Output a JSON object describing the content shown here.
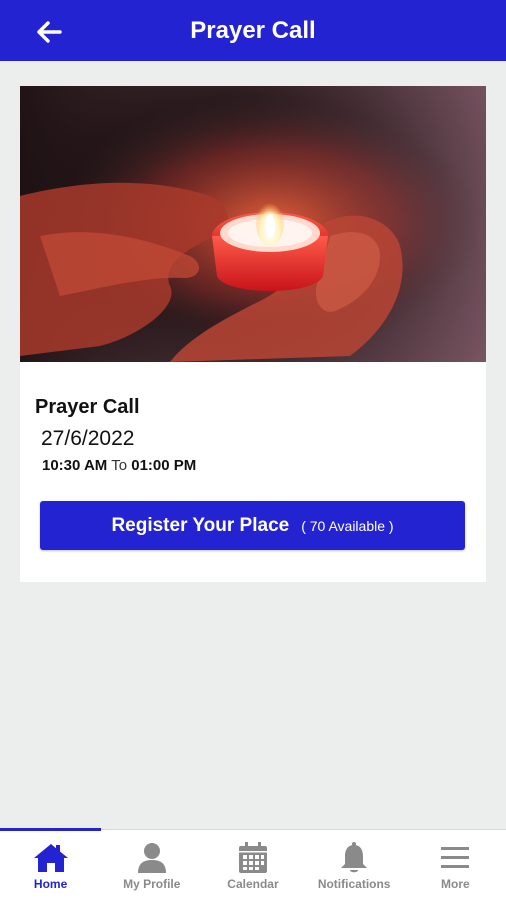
{
  "header": {
    "title": "Prayer Call",
    "back_icon": "arrow-left-icon",
    "background": "#2323d1"
  },
  "event": {
    "image": "candle-in-hands-photo",
    "title": "Prayer Call",
    "date": "27/6/2022",
    "start_time": "10:30 AM",
    "to_label": "To",
    "end_time": "01:00 PM",
    "register_label": "Register Your Place",
    "available_label": "( 70 Available )"
  },
  "bottom_nav": {
    "items": [
      {
        "label": "Home",
        "icon": "home-icon",
        "active": true
      },
      {
        "label": "My Profile",
        "icon": "user-icon",
        "active": false
      },
      {
        "label": "Calendar",
        "icon": "calendar-icon",
        "active": false
      },
      {
        "label": "Notifications",
        "icon": "bell-icon",
        "active": false
      },
      {
        "label": "More",
        "icon": "menu-icon",
        "active": false
      }
    ]
  },
  "colors": {
    "accent": "#2323d1",
    "inactive": "#8a8a8a",
    "background": "#eceeee"
  }
}
